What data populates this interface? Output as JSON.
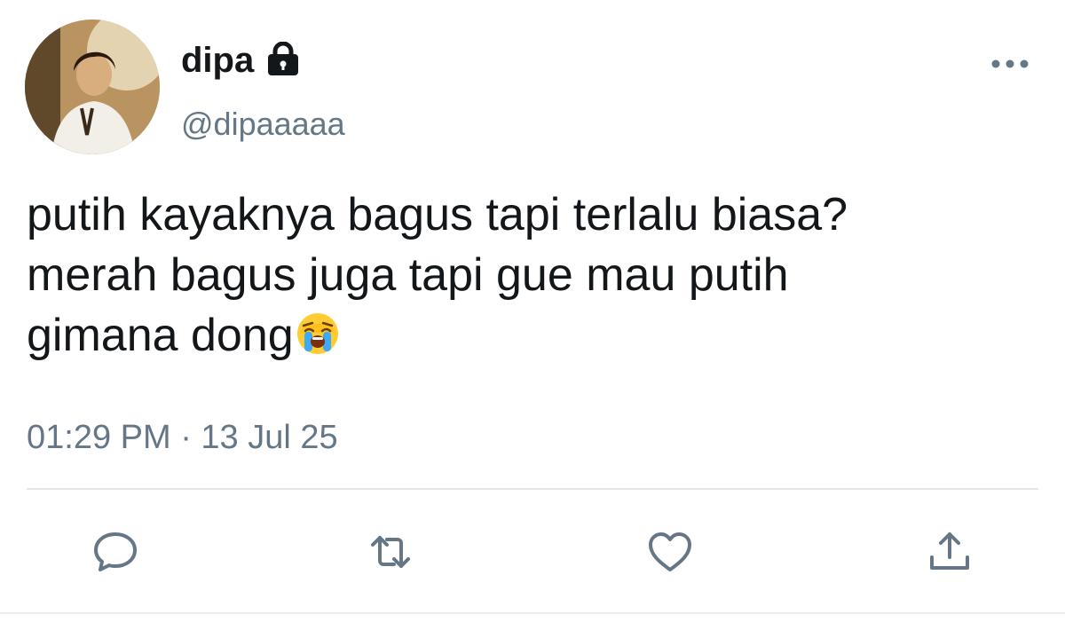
{
  "user": {
    "display_name": "dipa",
    "handle": "@dipaaaaa",
    "avatar_icon": "profile-photo",
    "protected_icon": "lock-icon"
  },
  "tweet": {
    "lines": [
      "putih kayaknya bagus tapi terlalu biasa?",
      "merah bagus juga tapi gue mau putih",
      "gimana dong"
    ],
    "emoji": "loudly-crying-face",
    "timestamp": "01:29 PM · 13 Jul 25"
  },
  "actions": [
    {
      "name": "reply",
      "icon": "comment-icon"
    },
    {
      "name": "retweet",
      "icon": "retweet-icon"
    },
    {
      "name": "like",
      "icon": "heart-icon"
    },
    {
      "name": "share",
      "icon": "share-icon"
    }
  ],
  "colors": {
    "text_primary": "#14171a",
    "text_secondary": "#657786",
    "icon": "#657786",
    "divider": "#e1e8ed"
  }
}
